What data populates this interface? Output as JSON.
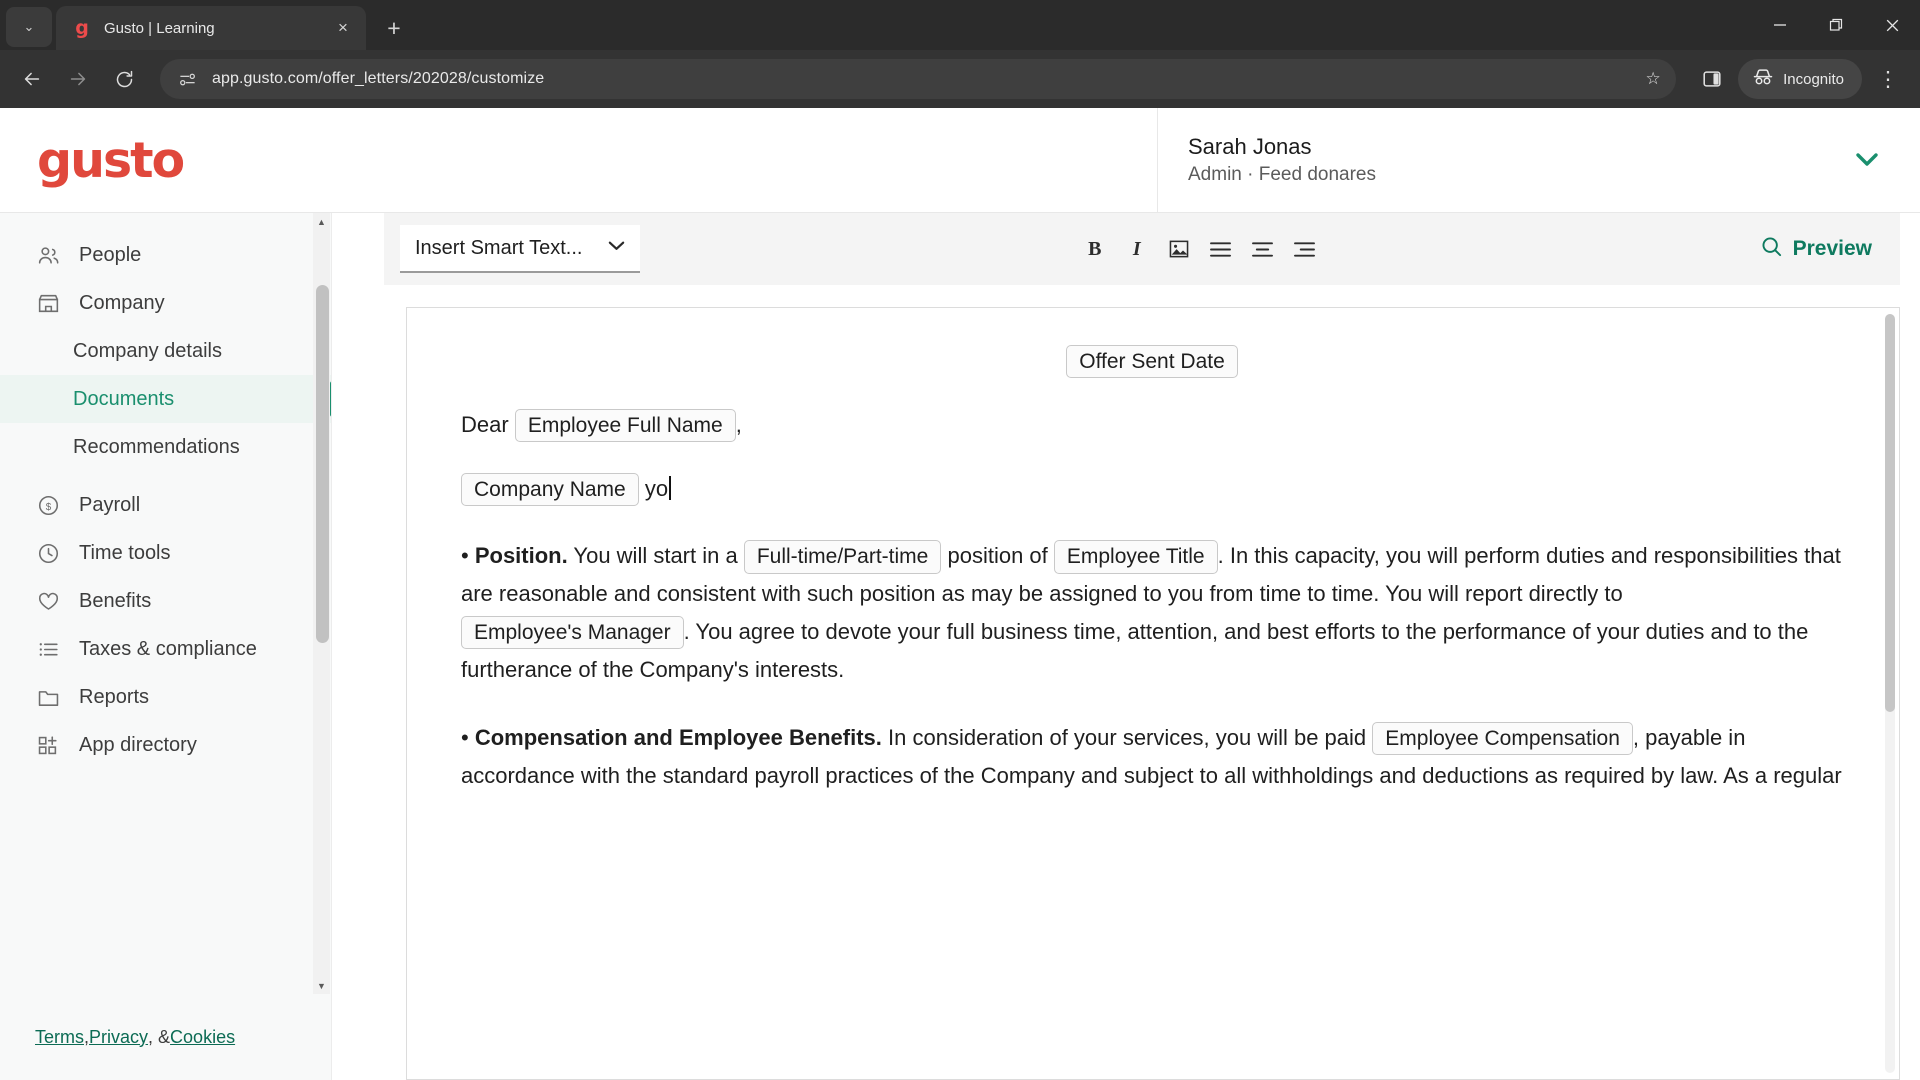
{
  "browser": {
    "tab": {
      "title": "Gusto | Learning",
      "favicon": "gusto-g-favicon",
      "close_label": "×"
    },
    "new_tab_label": "+",
    "tab_list_caret": "⌄",
    "window": {
      "minimize": "—",
      "maximize": "❐",
      "close": "✕"
    },
    "nav": {
      "back": "←",
      "forward": "→",
      "reload": "↻"
    },
    "omnibox": {
      "url": "app.gusto.com/offer_letters/202028/customize",
      "site_info_icon": "page-info-icon",
      "bookmark_icon": "☆"
    },
    "side_panel_icon": "side-panel-icon",
    "incognito_label": "Incognito",
    "menu_icon": "⋮"
  },
  "header": {
    "logo_text": "gusto",
    "user_name": "Sarah Jonas",
    "user_role": "Admin · Feed donares",
    "caret": "⌄"
  },
  "sidebar": {
    "items": [
      {
        "label": "People",
        "icon": "people-icon",
        "type": "top"
      },
      {
        "label": "Company",
        "icon": "company-icon",
        "type": "top"
      },
      {
        "label": "Company details",
        "type": "sub",
        "active": false
      },
      {
        "label": "Documents",
        "type": "sub",
        "active": true
      },
      {
        "label": "Recommendations",
        "type": "sub",
        "active": false
      },
      {
        "label": "Payroll",
        "icon": "payroll-icon",
        "type": "top"
      },
      {
        "label": "Time tools",
        "icon": "clock-icon",
        "type": "top"
      },
      {
        "label": "Benefits",
        "icon": "heart-icon",
        "type": "top"
      },
      {
        "label": "Taxes & compliance",
        "icon": "list-icon",
        "type": "top"
      },
      {
        "label": "Reports",
        "icon": "folder-icon",
        "type": "top"
      },
      {
        "label": "App directory",
        "icon": "apps-icon",
        "type": "top"
      }
    ],
    "footer": {
      "terms": "Terms",
      "privacy": "Privacy",
      "cookies": "Cookies",
      "sep1": ", ",
      "sep2": ", & "
    },
    "scroll_up_arrow": "▲",
    "scroll_down_arrow": "▼"
  },
  "editor": {
    "smart_text_label": "Insert Smart Text...",
    "smart_text_caret": "⌄",
    "format_buttons": [
      {
        "name": "bold-button",
        "glyph": "B"
      },
      {
        "name": "italic-button",
        "glyph": "I"
      },
      {
        "name": "insert-image-button",
        "glyph": "Ὓc"
      },
      {
        "name": "align-left-button",
        "glyph": "≡"
      },
      {
        "name": "align-center-button",
        "glyph": "≡"
      },
      {
        "name": "align-right-button",
        "glyph": "≡"
      }
    ],
    "preview_label": "Preview",
    "preview_icon": "search-icon"
  },
  "document": {
    "offer_sent_date_token": "Offer Sent Date",
    "salutation_prefix": "Dear",
    "employee_full_name_token": "Employee Full Name",
    "salutation_suffix": ",",
    "company_name_token": "Company Name",
    "typed_text": "yo",
    "position": {
      "bullet": "•",
      "heading": "Position.",
      "t1": " You will start in a ",
      "token1": "Full-time/Part-time",
      "t2": " position of ",
      "token2": "Employee Title",
      "t3": ". In this capacity, you will perform duties and responsibilities that are reasonable and consistent with such position as may be assigned to you from time to time. You will report directly to ",
      "token3": "Employee's Manager",
      "t4": ". You agree to devote your full business time, attention, and best efforts to the performance of your duties and to the furtherance of the Company's interests."
    },
    "compensation": {
      "bullet": "•",
      "heading": "Compensation and Employee Benefits.",
      "t1": " In consideration of your services, you will be paid ",
      "token1": "Employee Compensation",
      "t2": ", payable in accordance with the standard payroll practices of the Company and subject to all withholdings and deductions as required by law. As a regular"
    }
  },
  "colors": {
    "brand_red": "#e0483c",
    "accent_green": "#1a8f6e",
    "link_green": "#0c6b54",
    "chrome_dark": "#333333"
  }
}
